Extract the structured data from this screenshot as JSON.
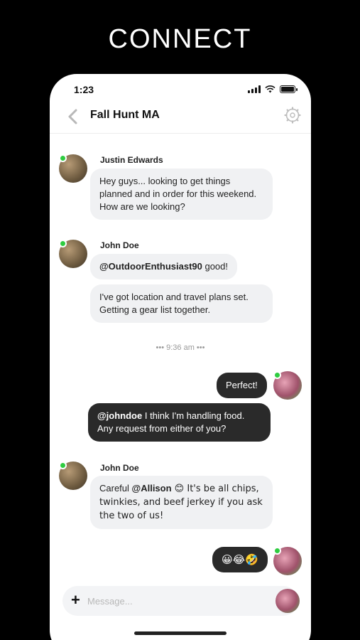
{
  "headline": "CONNECT",
  "status_bar": {
    "time": "1:23"
  },
  "nav": {
    "title": "Fall Hunt MA"
  },
  "messages": [
    {
      "sender": "Justin Edwards",
      "text": "Hey guys... looking to get things planned and in order for this weekend. How are we looking?"
    },
    {
      "sender": "John Doe",
      "mention": "@OutdoorEnthusiast90",
      "text": " good!"
    },
    {
      "text": "I've got location and travel plans set. Getting a gear list together."
    },
    {
      "timestamp": "••• 9:36 am •••"
    },
    {
      "text": "Perfect!"
    },
    {
      "mention": "@johndoe",
      "text": " I think I'm handling food. Any request from either of you?"
    },
    {
      "sender": "John Doe",
      "prefix": "Careful ",
      "mention": "@Allison",
      "text": " 😊 It's be all chips, twinkies, and beef jerkey if you ask the two of us!"
    },
    {
      "text": "😀😂🤣"
    }
  ],
  "composer": {
    "plus_label": "+",
    "placeholder": "Message..."
  },
  "colors": {
    "online": "#2ecc40",
    "outgoing_bubble": "#2a2a2a",
    "incoming_bubble": "#f0f1f3"
  }
}
